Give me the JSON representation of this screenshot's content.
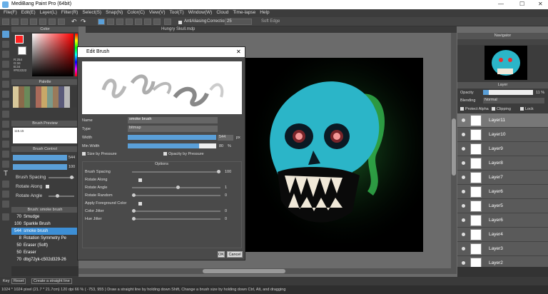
{
  "app": {
    "title": "MediBang Paint Pro (64bit)",
    "document_tab": "Hungry Skull.mdp"
  },
  "menu": [
    "File(F)",
    "Edit(E)",
    "Layer(L)",
    "Filter(R)",
    "Select(S)",
    "Snap(N)",
    "Color(C)",
    "View(V)",
    "Tool(T)",
    "Window(W)",
    "Cloud",
    "Time-lapse",
    "Help"
  ],
  "toolbar": {
    "antialiasing_label": "AntiAliasing",
    "correction_label": "Correction",
    "correction_value": "25",
    "soft_edge_label": "Soft Edge"
  },
  "left_panel": {
    "color_header": "Color",
    "rgb_lines": [
      "R:254",
      "G:34",
      "B:34",
      "#FE2222"
    ],
    "palette_header": "Palette",
    "brush_preview_header": "Brush Preview",
    "brush_preview_size": "115.15",
    "brush_control_header": "Brush Control",
    "brush_size_value": "544",
    "brush_opacity_value": "100",
    "brush_spacing_label": "Brush Spacing",
    "rotate_along_label": "Rotate Along",
    "rotate_angle_label": "Rotate Angle",
    "brush_list_header": "Brush: smoke brush",
    "brushes": [
      {
        "size": "70",
        "name": "Smudge"
      },
      {
        "size": "100",
        "name": "Sparkle Brush"
      },
      {
        "size": "544",
        "name": "smoke brush"
      },
      {
        "size": "8",
        "name": "Rotation Symmetry Pe"
      },
      {
        "size": "50",
        "name": "Eraser (Soft)"
      },
      {
        "size": "50",
        "name": "Eraser"
      },
      {
        "size": "70",
        "name": "dbg72yk-c502d329-26"
      }
    ]
  },
  "dialog": {
    "title": "Edit Brush",
    "name_label": "Name",
    "name_value": "smoke brush",
    "type_label": "Type",
    "type_value": "bitmap",
    "width_label": "Width",
    "width_value": "544",
    "width_unit": "px",
    "min_width_label": "Min Width",
    "min_width_value": "80",
    "min_width_unit": "%",
    "size_by_pressure": "Size by Pressure",
    "opacity_by_pressure": "Opacity by Pressure",
    "options_header": "Options",
    "options": [
      {
        "label": "Brush Spacing",
        "value": "100"
      },
      {
        "label": "Rotate Along",
        "value": ""
      },
      {
        "label": "Rotate Angle",
        "value": "1"
      },
      {
        "label": "Rotate Random",
        "value": "0"
      },
      {
        "label": "Apply Foreground Color",
        "value": ""
      },
      {
        "label": "Color Jitter",
        "value": "0"
      },
      {
        "label": "Hue Jitter",
        "value": "0"
      }
    ],
    "ok_label": "OK",
    "cancel_label": "Cancel"
  },
  "right_panel": {
    "navigator_header": "Navigator",
    "layer_header": "Layer",
    "opacity_label": "Opacity",
    "opacity_value": "11 %",
    "blending_label": "Blending",
    "blending_value": "Normal",
    "protect_alpha": "Protect Alpha",
    "clipping": "Clipping",
    "lock": "Lock",
    "layers": [
      "Layer11",
      "Layer10",
      "Layer9",
      "Layer8",
      "Layer7",
      "Layer6",
      "Layer5",
      "Layer6",
      "Layer4",
      "Layer3",
      "Layer2"
    ]
  },
  "bottom": {
    "key_label": "Key",
    "reset_label": "Reset",
    "create_line_label": "Create a straight line"
  },
  "status": {
    "text": "1024 * 1024 pixel   (21.7 * 21.7cm)   120 dpi   66 %   ( -753, 955 )   Draw a straight line by holding down Shift, Change a brush size by holding down Ctrl, Alt, and dragging"
  },
  "colors": {
    "foreground": "#FE2222",
    "accent": "#3d8fd6"
  }
}
